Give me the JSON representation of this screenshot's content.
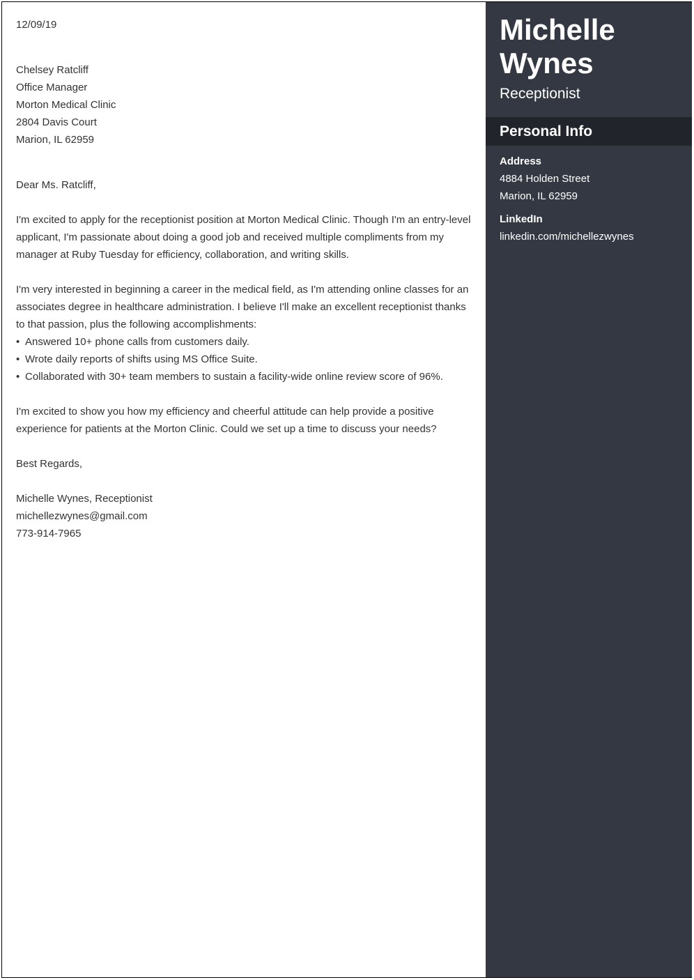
{
  "letter": {
    "date": "12/09/19",
    "recipient": {
      "name": "Chelsey Ratcliff",
      "title": "Office Manager",
      "company": "Morton Medical Clinic",
      "street": "2804 Davis Court",
      "city": "Marion, IL 62959"
    },
    "salutation": "Dear Ms. Ratcliff,",
    "paragraph1": [
      "I'm excited to apply for the receptionist position at Morton Medical Clinic. Though I'm an entry-level",
      "applicant, I'm passionate about doing a good job and received multiple compliments from my",
      "manager at Ruby Tuesday for efficiency, collaboration, and writing skills."
    ],
    "paragraph2": [
      "I'm very interested in beginning a career in the medical field, as I'm attending online classes for an",
      "associates degree in healthcare administration. I believe I'll make an excellent receptionist thanks",
      "to that passion, plus the following accomplishments:"
    ],
    "bullets": [
      "Answered 10+ phone calls from customers daily.",
      "Wrote daily reports of shifts using MS Office Suite.",
      "Collaborated with 30+ team members to sustain a facility-wide online review score of 96%."
    ],
    "bullet_glyph": "•",
    "paragraph3": [
      "I'm excited to show you how my efficiency and cheerful attitude can help provide a positive",
      "experience for patients at the Morton Clinic. Could we set up a time to discuss your needs?"
    ],
    "closing": "Best Regards,",
    "signature": {
      "name": "Michelle Wynes, Receptionist",
      "email": "michellezwynes@gmail.com",
      "phone": "773-914-7965"
    }
  },
  "sidebar": {
    "first_name": "Michelle",
    "last_name": "Wynes",
    "job_title": "Receptionist",
    "section_title": "Personal Info",
    "address_label": "Address",
    "address_line1": "4884 Holden Street",
    "address_line2": "Marion, IL 62959",
    "linkedin_label": "LinkedIn",
    "linkedin_value": "linkedin.com/michellezwynes"
  },
  "colors": {
    "sidebar_bg": "#333842",
    "section_band_bg": "#21242b",
    "body_text": "#333333"
  }
}
